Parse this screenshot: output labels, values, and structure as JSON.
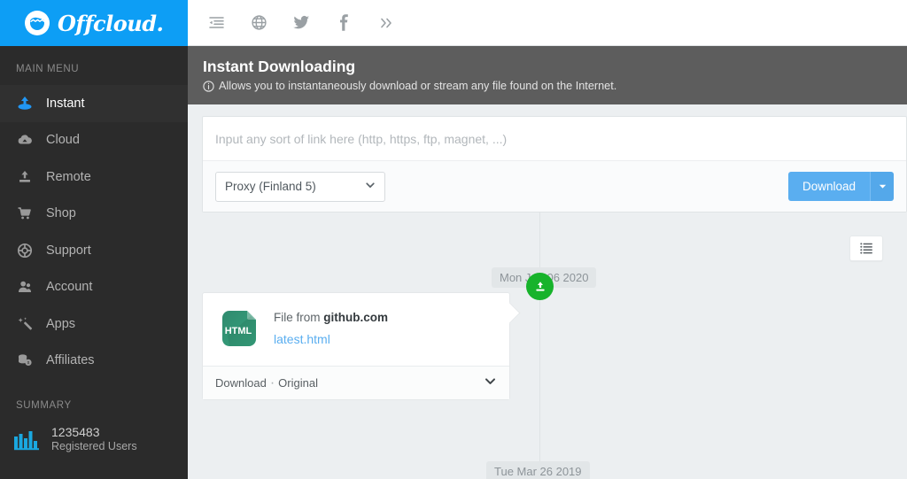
{
  "brand": {
    "name": "Offcloud.",
    "logo_icon": "offcloud-wave-icon",
    "accent_color": "#0d9ef5"
  },
  "sidebar": {
    "main_menu_label": "MAIN MENU",
    "summary_label": "SUMMARY",
    "items": [
      {
        "label": "Instant",
        "icon": "instant-download-icon",
        "active": true
      },
      {
        "label": "Cloud",
        "icon": "cloud-download-icon",
        "active": false
      },
      {
        "label": "Remote",
        "icon": "remote-upload-icon",
        "active": false
      },
      {
        "label": "Shop",
        "icon": "shopping-cart-icon",
        "active": false
      },
      {
        "label": "Support",
        "icon": "lifebuoy-icon",
        "active": false
      },
      {
        "label": "Account",
        "icon": "user-account-icon",
        "active": false
      },
      {
        "label": "Apps",
        "icon": "magic-wand-icon",
        "active": false
      },
      {
        "label": "Affiliates",
        "icon": "coins-stack-icon",
        "active": false
      }
    ],
    "summary": {
      "icon": "bar-chart-icon",
      "value": "1235483",
      "caption": "Registered Users"
    }
  },
  "topbar": {
    "icons": [
      {
        "name": "sidebar-collapse-icon"
      },
      {
        "name": "globe-icon"
      },
      {
        "name": "twitter-icon"
      },
      {
        "name": "facebook-icon"
      },
      {
        "name": "chevron-double-right-icon"
      }
    ]
  },
  "header": {
    "title": "Instant Downloading",
    "info_icon": "info-circle-icon",
    "subtitle": "Allows you to instantaneously download or stream any file found on the Internet."
  },
  "form": {
    "url_placeholder": "Input any sort of link here (http, https, ftp, magnet, ...)",
    "url_value": "",
    "proxy_selected": "Proxy (Finland 5)",
    "proxy_options": [
      "Proxy (Finland 5)"
    ],
    "download_label": "Download",
    "download_caret_icon": "caret-down-icon"
  },
  "timeline": {
    "list_view_icon": "list-view-icon",
    "dates": [
      {
        "label": "Mon Jan 06 2020"
      },
      {
        "label": "Tue Mar 26 2019"
      }
    ],
    "marker_icon": "download-tray-icon",
    "item": {
      "file_type": "HTML",
      "file_icon": "html-file-icon",
      "source_prefix": "File from ",
      "source_domain": "github.com",
      "file_name": "latest.html",
      "action_label": "Download",
      "separator": "·",
      "variant_label": "Original",
      "expand_icon": "chevron-down-icon"
    }
  }
}
